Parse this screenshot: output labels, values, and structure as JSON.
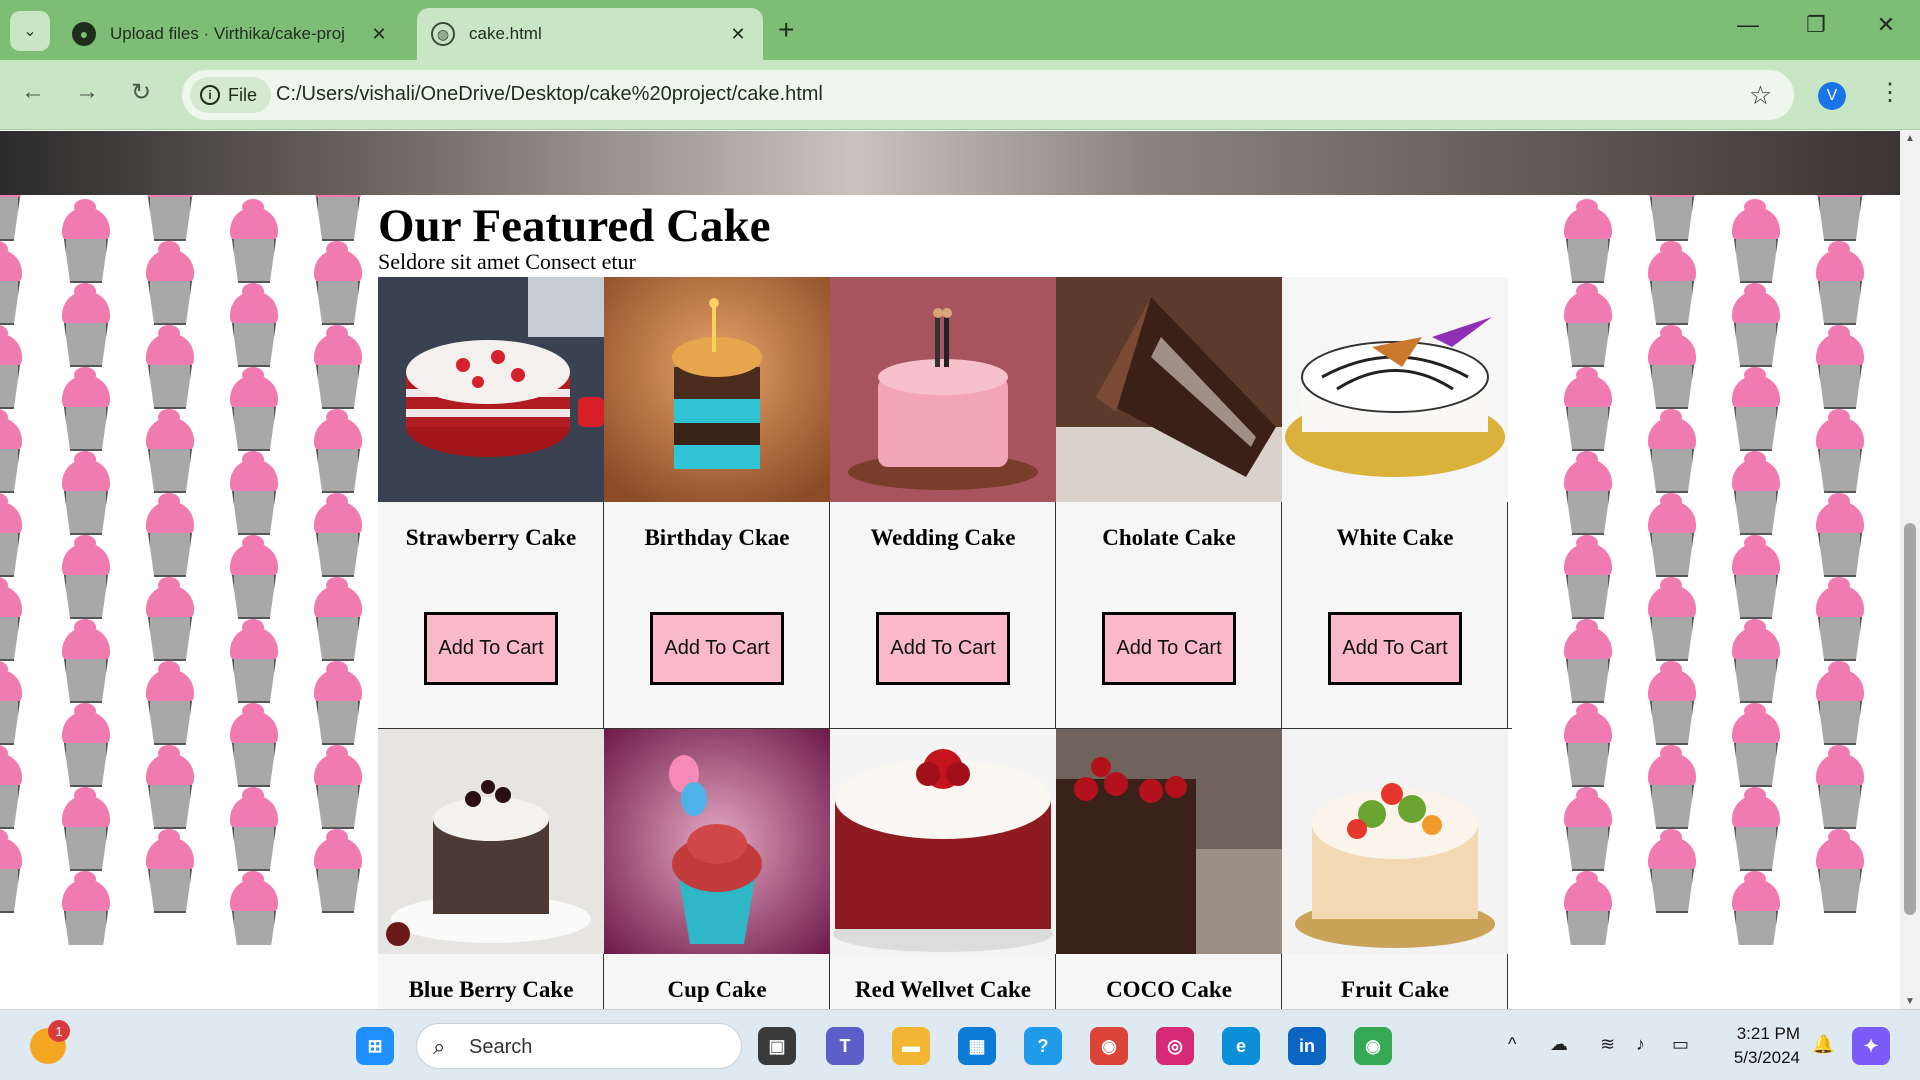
{
  "browser": {
    "tabs": [
      {
        "title": "Upload files · Virthika/cake-proj",
        "icon": "github-icon",
        "active": false
      },
      {
        "title": "cake.html",
        "icon": "globe-icon",
        "active": true
      }
    ],
    "new_tab": "+",
    "address": {
      "chip": "File",
      "url": "C:/Users/vishali/OneDrive/Desktop/cake%20project/cake.html"
    },
    "profile_initial": "V"
  },
  "page": {
    "title": "Our Featured Cake",
    "subtitle": "Seldore sit amet Consect etur",
    "cart_label": "Add To Cart",
    "row1": [
      {
        "name": "Strawberry Cake"
      },
      {
        "name": "Birthday Ckae"
      },
      {
        "name": "Wedding Cake"
      },
      {
        "name": "Cholate Cake"
      },
      {
        "name": "White Cake"
      }
    ],
    "row2": [
      {
        "name": "Blue Berry Cake"
      },
      {
        "name": "Cup Cake"
      },
      {
        "name": "Red Wellvet Cake"
      },
      {
        "name": "COCO Cake"
      },
      {
        "name": "Fruit Cake"
      }
    ]
  },
  "taskbar": {
    "search_placeholder": "Search",
    "weather_badge": "1",
    "time": "3:21 PM",
    "date": "5/3/2024"
  },
  "colors": {
    "tabbar": "#7ebd76",
    "toolbar": "#c9e6c4",
    "button": "#f9b9c9",
    "frosting": "#f07bb0"
  }
}
